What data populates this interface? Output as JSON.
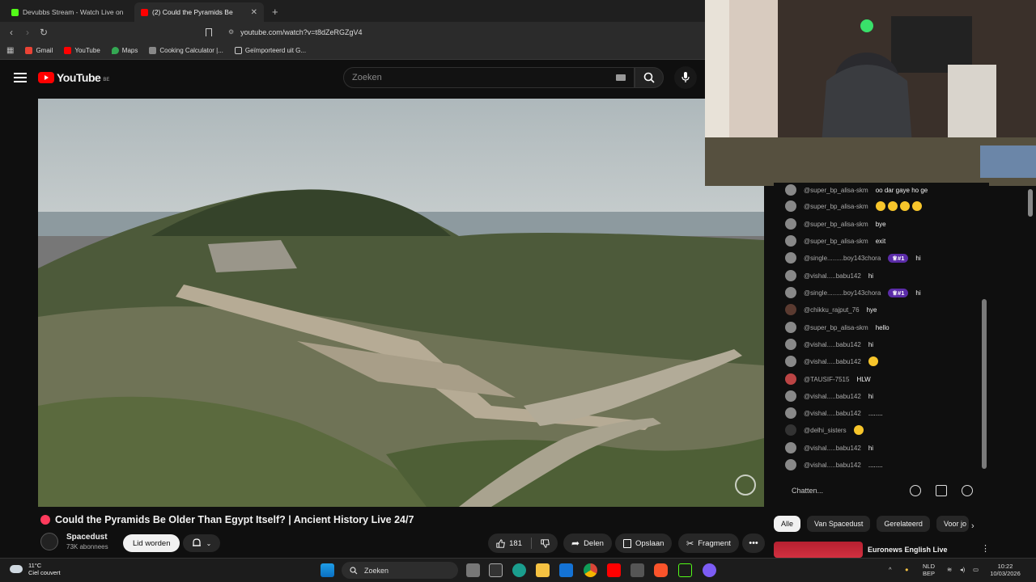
{
  "browser": {
    "tabs": [
      {
        "title": "Devubbs Stream - Watch Live on",
        "favicon_color": "#53fc18",
        "active": false
      },
      {
        "title": "(2) Could the Pyramids Be",
        "favicon_color": "#ff0000",
        "active": true
      }
    ],
    "url": "youtube.com/watch?v=t8dZeRGZgV4",
    "bookmarks": [
      {
        "label": "Gmail",
        "color": "#ea4335"
      },
      {
        "label": "YouTube",
        "color": "#ff0000"
      },
      {
        "label": "Maps",
        "color": "#34a853"
      },
      {
        "label": "Cooking Calculator |...",
        "color": "#888888"
      },
      {
        "label": "Geïmporteerd uit G...",
        "color": "#cccccc"
      }
    ]
  },
  "youtube": {
    "logo_text": "YouTube",
    "country": "BE",
    "search_placeholder": "Zoeken"
  },
  "video": {
    "title": "Could the Pyramids Be Older Than Egypt Itself? | Ancient History Live 24/7",
    "channel": "Spacedust",
    "subscribers": "73K abonnees",
    "join_label": "Lid worden",
    "likes": "181",
    "share_label": "Delen",
    "save_label": "Opslaan",
    "clip_label": "Fragment"
  },
  "chat": {
    "messages": [
      {
        "author": "@super_bp_alisa-skm",
        "text": "oo dar gaye ho ge"
      },
      {
        "author": "@super_bp_alisa-skm",
        "text": "",
        "emoji_count": 4
      },
      {
        "author": "@super_bp_alisa-skm",
        "text": "bye"
      },
      {
        "author": "@super_bp_alisa-skm",
        "text": "exit"
      },
      {
        "author": "@single.........boy143chora",
        "badge": "#1",
        "text": "hi"
      },
      {
        "author": "@vishal.....babu142",
        "text": "hi"
      },
      {
        "author": "@single.........boy143chora",
        "badge": "#1",
        "text": "hi"
      },
      {
        "author": "@chikku_rajput_76",
        "text": "hye"
      },
      {
        "author": "@super_bp_alisa-skm",
        "text": "hello"
      },
      {
        "author": "@vishal.....babu142",
        "text": "hi"
      },
      {
        "author": "@vishal.....babu142",
        "text": "",
        "emoji_count": 1
      },
      {
        "author": "@TAUSIF-7515",
        "text": "HLW"
      },
      {
        "author": "@vishal.....babu142",
        "text": "hi"
      },
      {
        "author": "@vishal.....babu142",
        "text": "........"
      },
      {
        "author": "@delhi_sisters",
        "text": "",
        "emoji_count": 1
      },
      {
        "author": "@vishal.....babu142",
        "text": "hi"
      },
      {
        "author": "@vishal.....babu142",
        "text": "........"
      }
    ],
    "input_placeholder": "Chatten..."
  },
  "chips": [
    "Alle",
    "Van Spacedust",
    "Gerelateerd",
    "Voor jo"
  ],
  "related": {
    "title": "Euronews English Live"
  },
  "taskbar": {
    "temperature": "11°C",
    "weather_text": "Ciel couvert",
    "search_label": "Zoeken",
    "lang_line1": "NLD",
    "lang_line2": "BEP",
    "time": "10:22",
    "date": "10/03/2026"
  }
}
